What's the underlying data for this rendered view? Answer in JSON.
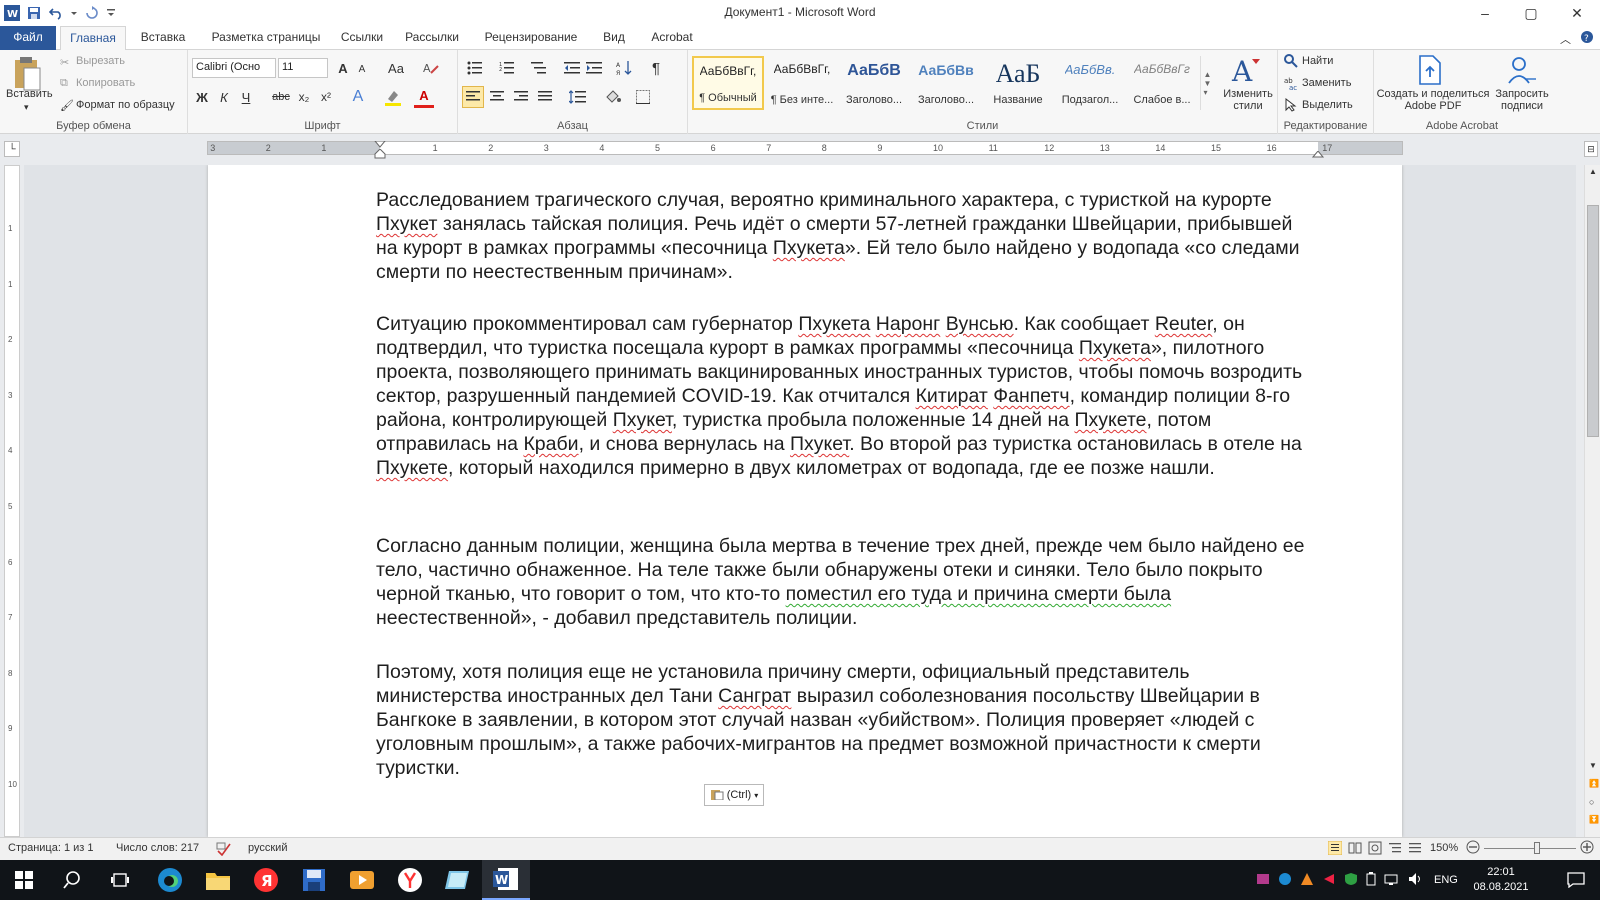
{
  "window": {
    "title": "Документ1 - Microsoft Word",
    "controls": [
      "–",
      "▢",
      "✕"
    ]
  },
  "tabs": [
    {
      "label": "Файл"
    },
    {
      "label": "Главная"
    },
    {
      "label": "Вставка"
    },
    {
      "label": "Разметка страницы"
    },
    {
      "label": "Ссылки"
    },
    {
      "label": "Рассылки"
    },
    {
      "label": "Рецензирование"
    },
    {
      "label": "Вид"
    },
    {
      "label": "Acrobat"
    }
  ],
  "clipboard": {
    "paste": "Вставить",
    "cut": "Вырезать",
    "copy": "Копировать",
    "format_painter": "Формат по образцу",
    "group": "Буфер обмена"
  },
  "font": {
    "name": "Calibri (Осно",
    "size": "11",
    "group": "Шрифт",
    "bold": "Ж",
    "italic": "К",
    "underline": "Ч",
    "strike": "abc",
    "sub": "x₂",
    "sup": "x²",
    "grow": "A",
    "shrink": "A",
    "case": "Aa",
    "effects": "A",
    "color": "A"
  },
  "paragraph": {
    "group": "Абзац"
  },
  "styles": {
    "group": "Стили",
    "items": [
      {
        "preview": "АаБбВвГг,",
        "name": "¶ Обычный"
      },
      {
        "preview": "АаБбВвГг,",
        "name": "¶ Без инте..."
      },
      {
        "preview": "АаБбВ",
        "name": "Заголово..."
      },
      {
        "preview": "АаБбВв",
        "name": "Заголово..."
      },
      {
        "preview": "АаБ",
        "name": "Название"
      },
      {
        "preview": "АаБбВв.",
        "name": "Подзагол..."
      },
      {
        "preview": "АаБбВвГг",
        "name": "Слабое в..."
      }
    ],
    "change": "Изменить стили"
  },
  "editing": {
    "group": "Редактирование",
    "find": "Найти",
    "replace": "Заменить",
    "select": "Выделить"
  },
  "acrobat": {
    "group": "Adobe Acrobat",
    "create": "Создать и поделиться Adobe PDF",
    "request": "Запросить подписи"
  },
  "ruler": {
    "numbers": [
      "3",
      "2",
      "1",
      "1",
      "2",
      "3",
      "4",
      "5",
      "6",
      "7",
      "8",
      "9",
      "10",
      "11",
      "12",
      "13",
      "14",
      "15",
      "16",
      "17"
    ],
    "vnumbers": [
      "1",
      "1",
      "2",
      "3",
      "4",
      "5",
      "6",
      "7",
      "8",
      "9",
      "10",
      "11"
    ]
  },
  "document": {
    "paragraphs": [
      [
        {
          "t": "Расследованием трагического случая, вероятно криминального характера, с туристкой на курорте "
        },
        {
          "t": "Пхукет",
          "s": "sq"
        },
        {
          "t": " занялась тайская полиция. Речь идёт о смерти 57-летней гражданки Швейцарии, прибывшей на курорт в рамках программы «песочница "
        },
        {
          "t": "Пхукета",
          "s": "sq"
        },
        {
          "t": "». Ей тело было найдено у водопада «со следами смерти по неестественным причинам»."
        }
      ],
      [
        {
          "t": "Ситуацию прокомментировал сам губернатор "
        },
        {
          "t": "Пхукета",
          "s": "sq"
        },
        {
          "t": " "
        },
        {
          "t": "Наронг",
          "s": "sq"
        },
        {
          "t": " "
        },
        {
          "t": "Вунсью",
          "s": "sq"
        },
        {
          "t": ". Как сообщает "
        },
        {
          "t": "Reuter",
          "s": "sq"
        },
        {
          "t": ", он подтвердил, что туристка посещала курорт в рамках программы «песочница "
        },
        {
          "t": "Пхукета",
          "s": "sq"
        },
        {
          "t": "», пилотного проекта, позволяющего принимать вакцинированных иностранных туристов, чтобы помочь возродить сектор, разрушенный пандемией COVID-19. Как отчитался "
        },
        {
          "t": "Китират",
          "s": "sq"
        },
        {
          "t": " "
        },
        {
          "t": "Фанпетч",
          "s": "sq"
        },
        {
          "t": ", командир полиции 8-го района, контролирующей "
        },
        {
          "t": "Пхукет",
          "s": "sq"
        },
        {
          "t": ", туристка пробыла положенные 14 дней на "
        },
        {
          "t": "Пхукете",
          "s": "sq"
        },
        {
          "t": ", потом отправилась на "
        },
        {
          "t": "Краби",
          "s": "sq"
        },
        {
          "t": ", и снова вернулась на "
        },
        {
          "t": "Пхукет",
          "s": "sq"
        },
        {
          "t": ". Во второй раз туристка остановилась в отеле на "
        },
        {
          "t": "Пхукете",
          "s": "sq"
        },
        {
          "t": ", который находился примерно в двух километрах от водопада, где ее позже нашли."
        }
      ],
      [
        {
          "t": "Согласно данным полиции, женщина была мертва в течение трех дней, прежде чем было найдено ее тело, частично обнаженное. На теле также были обнаружены отеки и синяки. Тело было покрыто черной тканью, что говорит о том, что кто-то "
        },
        {
          "t": "поместил его туда и причина смерти была",
          "s": "sqg"
        },
        {
          "t": " неестественной», - добавил представитель полиции."
        }
      ],
      [
        {
          "t": "Поэтому, хотя полиция еще не установила причину смерти, официальный представитель министерства иностранных дел Тани "
        },
        {
          "t": "Санграт",
          "s": "sq"
        },
        {
          "t": " выразил соболезнования посольству Швейцарии в Бангкоке в заявлении, в котором этот случай назван «убийством». Полиция проверяет «людей с уголовным прошлым», а также рабочих-мигрантов на предмет возможной причастности к смерти туристки."
        }
      ]
    ],
    "paste_options": "(Ctrl)"
  },
  "status": {
    "page": "Страница: 1 из 1",
    "words": "Число слов: 217",
    "language": "русский",
    "zoom": "150%"
  },
  "taskbar": {
    "lang": "ENG",
    "time": "22:01",
    "date": "08.08.2021"
  },
  "colors": {
    "file_tab": "#2b579a",
    "taskbar": "#101418",
    "spell_error": "#d33",
    "grammar_error": "#3a3"
  }
}
